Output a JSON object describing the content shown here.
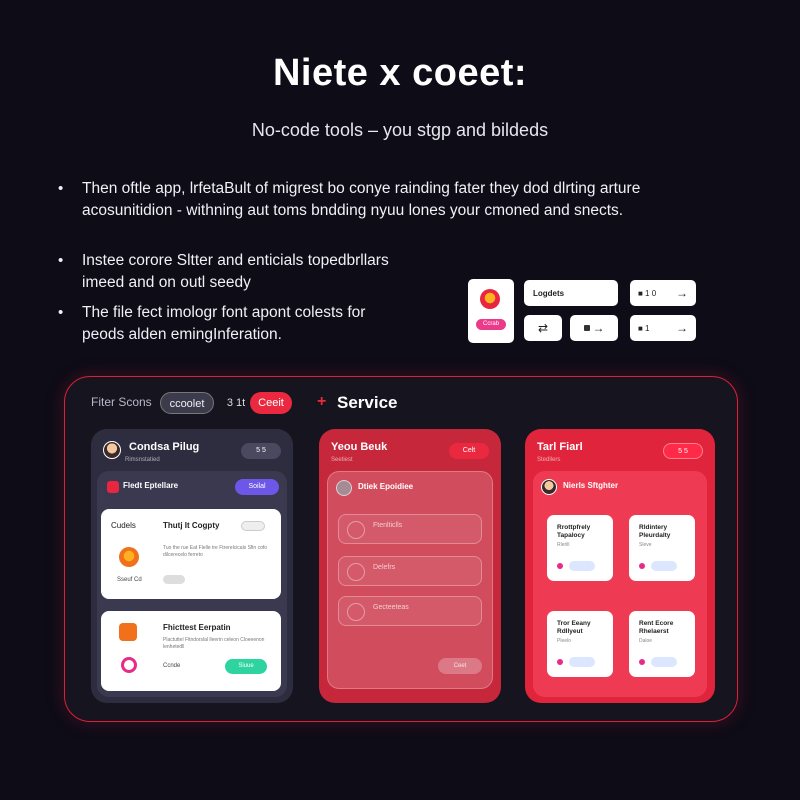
{
  "header": {
    "title": "Niete x coeet:",
    "subtitle": "No-code tools – you stgp and bildeds"
  },
  "bullets": [
    "Then oftle app, lrfetaBult of migrest bo conye rainding fater they dod dlrting arture acosunitidion - withning aut toms bndding nyuu lones your cmoned and snects.",
    "Instee corore Sltter and enticials topedbrllars imeed and on outl seedy",
    "The file fect imologr font apont colests for peods alden emingInferation."
  ],
  "mini_widgets": {
    "app_pill": "Ccrab",
    "btn1": "Logdets",
    "btn2_mid": "■ 1 0",
    "btn5_mid": "■ 1"
  },
  "frame": {
    "label": "Fiter Scons",
    "chip_a": "ccoolet",
    "chip_b": "3 1t",
    "chip_c": "Ceeit",
    "service": "Service"
  },
  "card1": {
    "title": "Condsa Pilug",
    "sub": "Rimsnstatied",
    "pill": "5 5",
    "inner_title": "Fledt Eptellare",
    "inner_pill": "Soilal",
    "w1_label": "Cudels",
    "w1_title": "Thutj It Cogpty",
    "w1_text": "Tuo the rue Eat Flelle tre Ftrerelcicals Sfin cofo dilcerecelo ferreto",
    "w1_foot": "Sseuf Cd",
    "w2_title": "Fhicttest Eerpatin",
    "w2_text": "Plactuttel Fitndorslal lleerin celeon Cloeeenon lenhetedll",
    "w2_foot": "Ccnde",
    "w2_btn": "Siuue"
  },
  "card2": {
    "title": "Yeou Beuk",
    "sub": "Seetiest",
    "pill": "Celt",
    "inner_title": "Dtiek Epoidiee",
    "rows": [
      "Ftenlticlls",
      "Delefrs",
      "Gecteeteas"
    ],
    "btn": "Ceet"
  },
  "card3": {
    "title": "Tarl Fiarl",
    "sub": "Stedllers",
    "pill": "5 5",
    "inner_title": "Nierls Sftghter",
    "tiles": [
      {
        "title": "Rrottpfrely Tapalocy",
        "sub": "Rlerill"
      },
      {
        "title": "Rldintery Pleurdalty",
        "sub": "Sleve"
      },
      {
        "title": "Tror Eeany Rdllyeut",
        "sub": "Pleelo"
      },
      {
        "title": "Rent Ecore Rhelaerst",
        "sub": "Daloe"
      }
    ]
  }
}
